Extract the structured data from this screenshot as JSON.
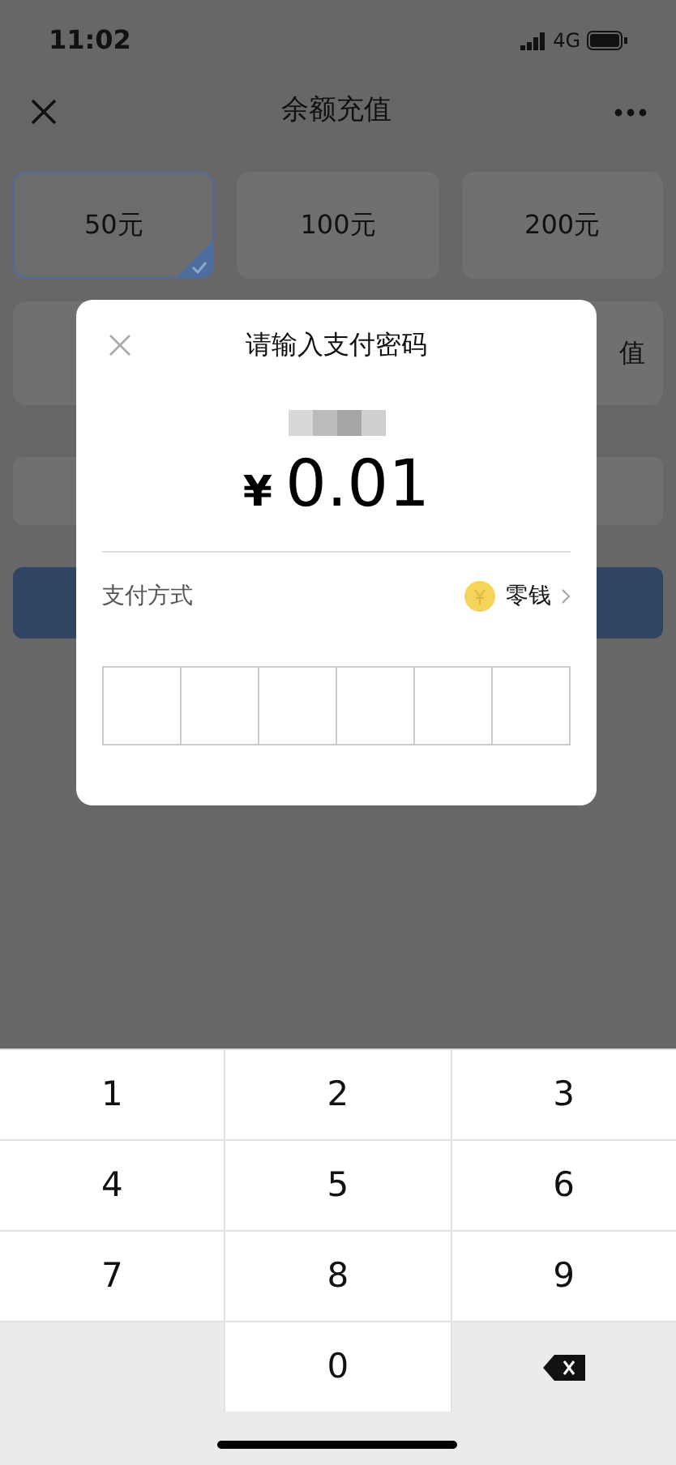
{
  "status_bar": {
    "time": "11:02",
    "network": "4G"
  },
  "nav": {
    "title": "余额充值"
  },
  "amount_options": [
    {
      "label": "50元",
      "selected": true
    },
    {
      "label": "100元",
      "selected": false
    },
    {
      "label": "200元",
      "selected": false
    }
  ],
  "partial_option_text": "值",
  "dialog": {
    "title": "请输入支付密码",
    "currency": "¥",
    "amount": "0.01",
    "method_label": "支付方式",
    "method": "零钱",
    "password_boxes": [
      {
        "filled": false
      },
      {
        "filled": false
      },
      {
        "filled": false
      },
      {
        "filled": false
      },
      {
        "filled": false
      },
      {
        "filled": false
      }
    ]
  },
  "keypad": [
    {
      "kind": "digit",
      "label": "1"
    },
    {
      "kind": "digit",
      "label": "2"
    },
    {
      "kind": "digit",
      "label": "3"
    },
    {
      "kind": "digit",
      "label": "4"
    },
    {
      "kind": "digit",
      "label": "5"
    },
    {
      "kind": "digit",
      "label": "6"
    },
    {
      "kind": "digit",
      "label": "7"
    },
    {
      "kind": "digit",
      "label": "8"
    },
    {
      "kind": "digit",
      "label": "9"
    },
    {
      "kind": "blank"
    },
    {
      "kind": "digit",
      "label": "0"
    },
    {
      "kind": "delete"
    }
  ]
}
